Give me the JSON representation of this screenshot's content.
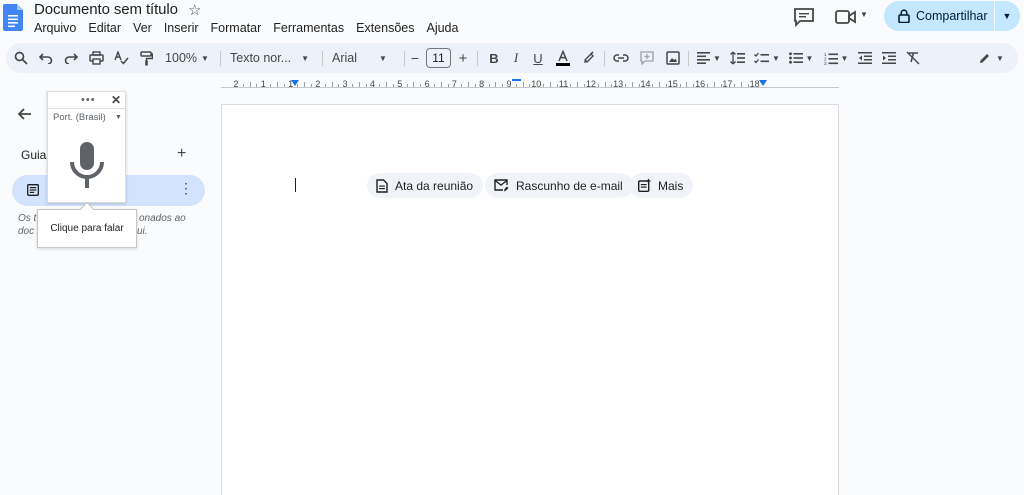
{
  "document": {
    "title": "Documento sem título"
  },
  "menubar": [
    "Arquivo",
    "Editar",
    "Ver",
    "Inserir",
    "Formatar",
    "Ferramentas",
    "Extensões",
    "Ajuda"
  ],
  "share": {
    "label": "Compartilhar"
  },
  "toolbar": {
    "zoom": "100%",
    "style": "Texto nor...",
    "font": "Arial",
    "font_size": "11",
    "minus": "−",
    "plus": "+"
  },
  "ruler": [
    "2",
    "1",
    "1",
    "2",
    "3",
    "4",
    "5",
    "6",
    "7",
    "8",
    "9",
    "10",
    "11",
    "12",
    "13",
    "14",
    "15",
    "16",
    "17",
    "18"
  ],
  "chips": [
    {
      "label": "Ata da reunião",
      "icon": "document-icon"
    },
    {
      "label": "Rascunho de e-mail",
      "icon": "email-draft-icon"
    },
    {
      "label": "Mais",
      "icon": "more-templates-icon"
    }
  ],
  "side_panel": {
    "title": "Guias",
    "text_line1_a": "Os t",
    "text_line1_b": "onados ao",
    "text_line2_a": "doc",
    "text_line2_b": "ui."
  },
  "voice_typing": {
    "dots": "•••",
    "close": "✕",
    "language": "Port. (Brasil)",
    "tooltip": "Clique para falar"
  },
  "colors": {
    "accent": "#1a73e8",
    "share_bg": "#c2e7ff",
    "toolbar_bg": "#edf2fa",
    "outline_bg": "#d3e3fd"
  }
}
